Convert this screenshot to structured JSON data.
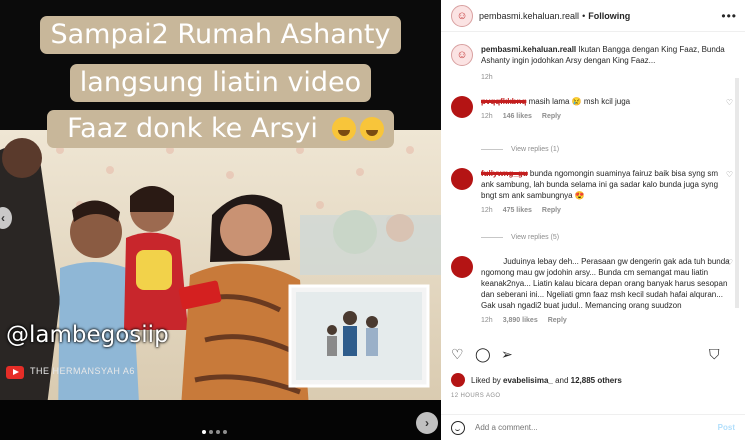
{
  "media": {
    "caption_lines": [
      "Sampai2 Rumah Ashanty",
      "langsung liatin video",
      "Faaz donk ke Arsyi"
    ],
    "watermark": "@lambegosiip",
    "channel": "THE HERMANSYAH A6",
    "colors": {
      "caption_bg": "#c8b79a",
      "background": "#000000"
    }
  },
  "header": {
    "username": "pembasmi.kehaluan.reall",
    "separator": "•",
    "follow_state": "Following",
    "more_icon": "more-icon"
  },
  "caption": {
    "username": "pembasmi.kehaluan.reall",
    "text": "Ikutan Bangga dengan King Faaz, Bunda Ashanty ingin jodohkan Arsy dengan King Faaz...",
    "time": "12h"
  },
  "comments": [
    {
      "username": "pvqqfkkbnq",
      "text": "masih lama 😢 msh kcil juga",
      "time": "12h",
      "likes": "146 likes",
      "reply": "Reply",
      "view_replies": "View replies (1)"
    },
    {
      "username": "fullywng_gu",
      "text": "bunda ngomongin suaminya fairuz baik bisa syng sm ank sambung, lah bunda selama ini ga sadar kalo bunda juga syng bngt sm ank sambungnya 😍",
      "time": "12h",
      "likes": "475 likes",
      "reply": "Reply",
      "view_replies": "View replies (5)"
    },
    {
      "username": "",
      "text": "Juduinya lebay deh... Perasaan gw dengerin gak ada tuh bunda ngomong mau gw jodohin arsy... Bunda cm semangat mau liatin keanak2nya... Liatin kalau bicara depan orang banyak harus sesopan dan seberani ini... Ngeliati gmn faaz msh kecil sudah hafai alquran... Gak usah ngadi2 buat judul.. Memancing orang suudzon",
      "time": "12h",
      "likes": "3,890 likes",
      "reply": "Reply"
    }
  ],
  "likes": {
    "prefix": "Liked by ",
    "user": "evabelisima_",
    "middle": " and ",
    "others": "12,885 others"
  },
  "time_ago": "12 HOURS AGO",
  "add_comment": {
    "placeholder": "Add a comment...",
    "post_label": "Post"
  }
}
